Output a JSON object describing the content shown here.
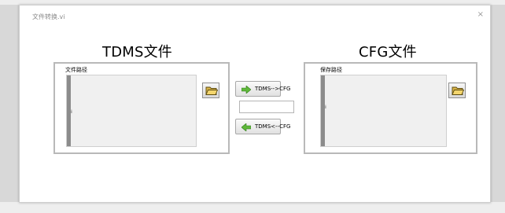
{
  "window": {
    "title": "文件转换.vi",
    "close_glyph": "×"
  },
  "left_panel": {
    "heading": "TDMS文件",
    "path_label": "文件路径",
    "path_value": "",
    "cursor_glyph": "⁞"
  },
  "right_panel": {
    "heading": "CFG文件",
    "path_label": "保存路径",
    "path_value": "",
    "cursor_glyph": "⁞"
  },
  "center": {
    "to_cfg_label": "TDMS-->CFG",
    "to_tdms_label": "TDMS<--CFG",
    "status_text": ""
  },
  "icons": {
    "folder": "folder-open-icon",
    "arrow_right": "arrow-right-icon",
    "arrow_left": "arrow-left-icon"
  },
  "colors": {
    "arrow_green": "#5fb83a",
    "folder_yellow": "#e8c458"
  }
}
